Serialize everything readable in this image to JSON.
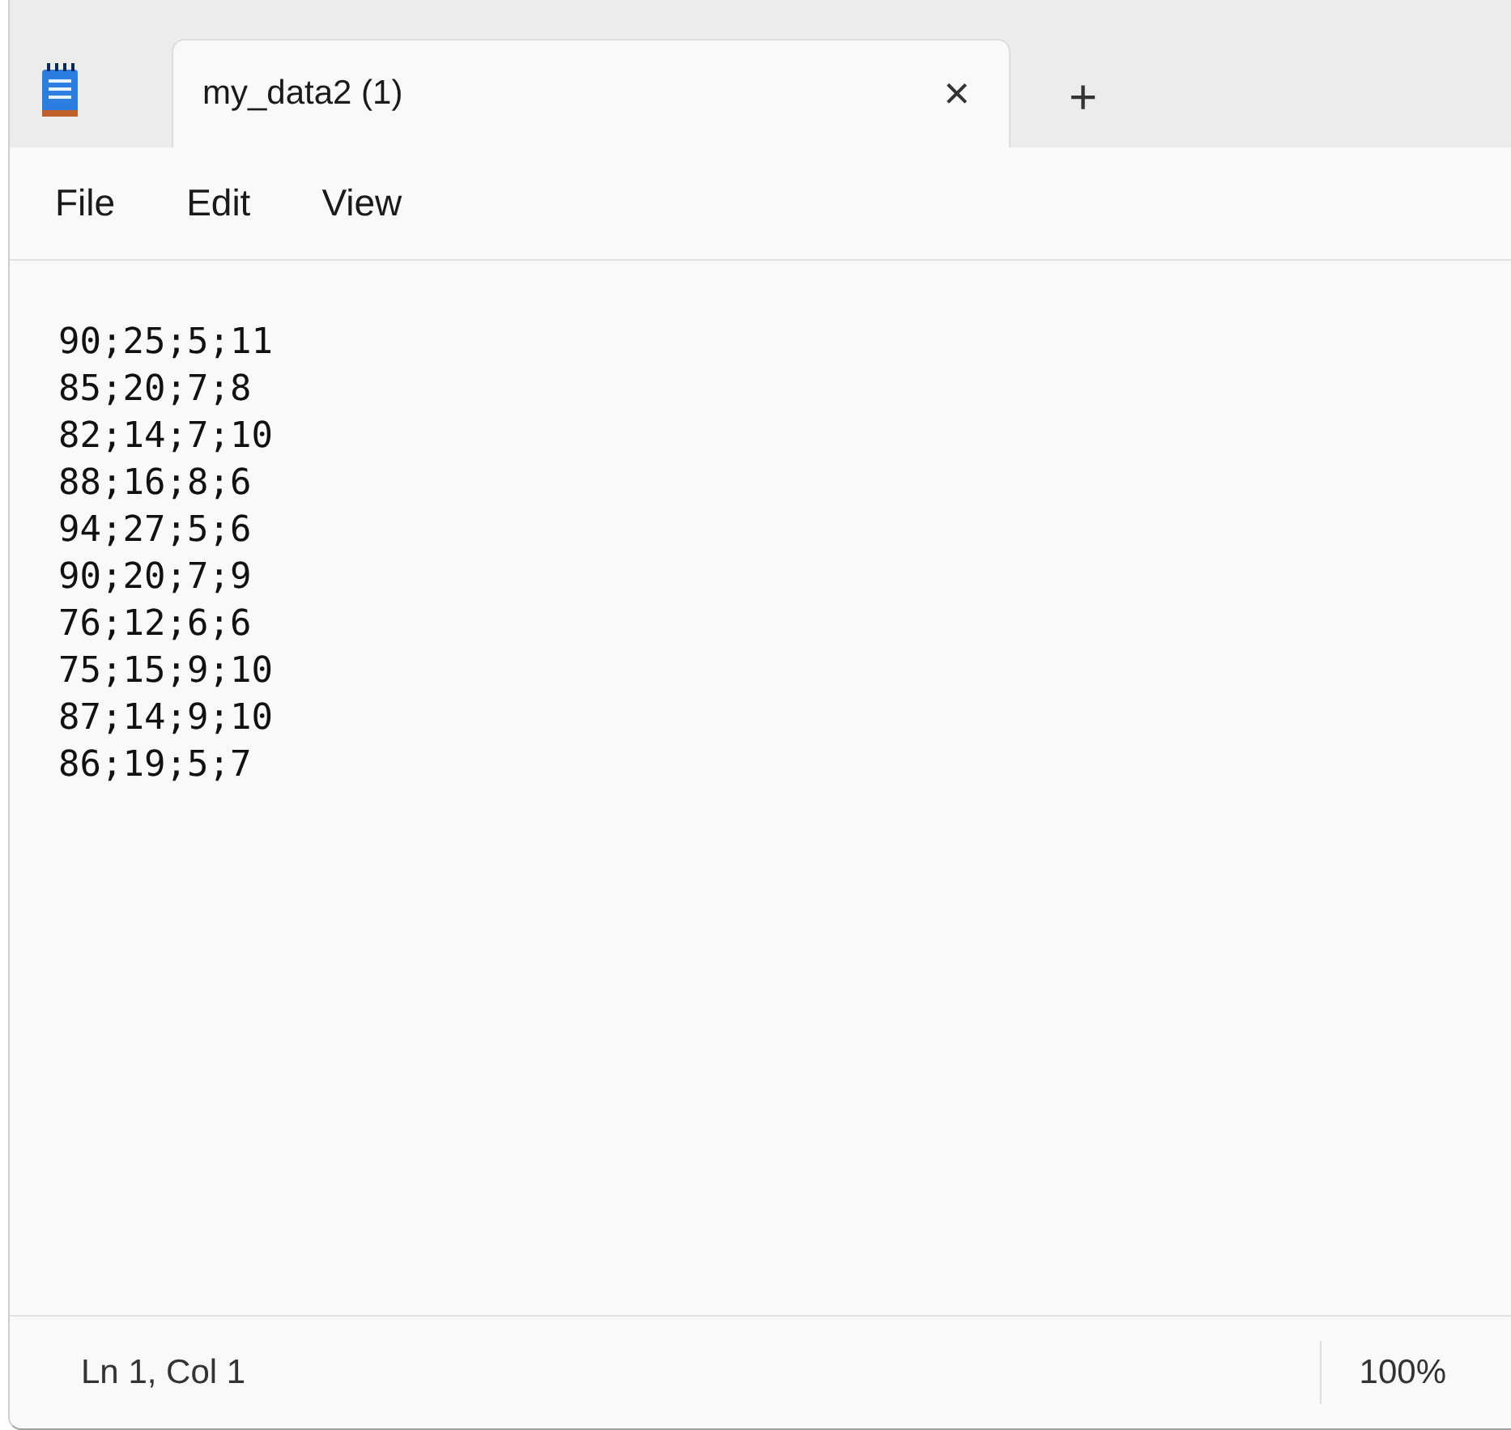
{
  "tabs": [
    {
      "label": "my_data2 (1)",
      "selected": true,
      "close": "×"
    }
  ],
  "new_tab": "+",
  "menu": [
    "File",
    "Edit",
    "View"
  ],
  "lines": [
    "90;25;5;11",
    "85;20;7;8",
    "82;14;7;10",
    "88;16;8;6",
    "94;27;5;6",
    "90;20;7;9",
    "76;12;6;6",
    "75;15;9;10",
    "87;14;9;10",
    "86;19;5;7"
  ],
  "status_bar": {
    "position": "Ln 1, Col 1",
    "zoom": "100%"
  }
}
